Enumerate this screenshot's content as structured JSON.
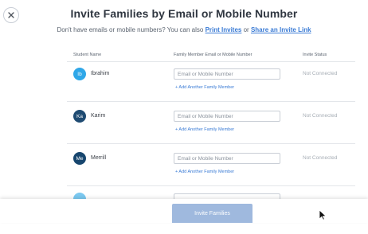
{
  "modal": {
    "title": "Invite Families by Email or Mobile Number",
    "subtitle_prefix": "Don't have emails or mobile numbers? You can also",
    "print_invites_label": "Print Invites",
    "subtitle_or": "or",
    "share_link_label": "Share an Invite Link"
  },
  "table": {
    "headers": {
      "student_name": "Student Name",
      "contact": "Family Member Email or Mobile Number",
      "status": "Invite Status"
    },
    "rows": [
      {
        "initials": "Ib",
        "name": "Ibrahim",
        "placeholder": "Email or Mobile Number",
        "add_label": "+ Add Another Family Member",
        "status": "Not Connected",
        "avatar_color": "#2fa7e8"
      },
      {
        "initials": "Ka",
        "name": "Karim",
        "placeholder": "Email or Mobile Number",
        "add_label": "+ Add Another Family Member",
        "status": "Not Connected",
        "avatar_color": "#1f4b72"
      },
      {
        "initials": "Me",
        "name": "Merrill",
        "placeholder": "Email or Mobile Number",
        "add_label": "+ Add Another Family Member",
        "status": "Not Connected",
        "avatar_color": "#17466e"
      },
      {
        "initials": "",
        "name": "",
        "placeholder": "",
        "avatar_color": "#7cc9f0"
      }
    ]
  },
  "footer": {
    "invite_button_label": "Invite Families"
  },
  "colors": {
    "accent": "#3a7bd5",
    "button_disabled": "#9fb9de",
    "muted": "#a6adb5"
  },
  "icons": {
    "close": "close-icon",
    "cursor": "mouse-pointer-icon"
  }
}
